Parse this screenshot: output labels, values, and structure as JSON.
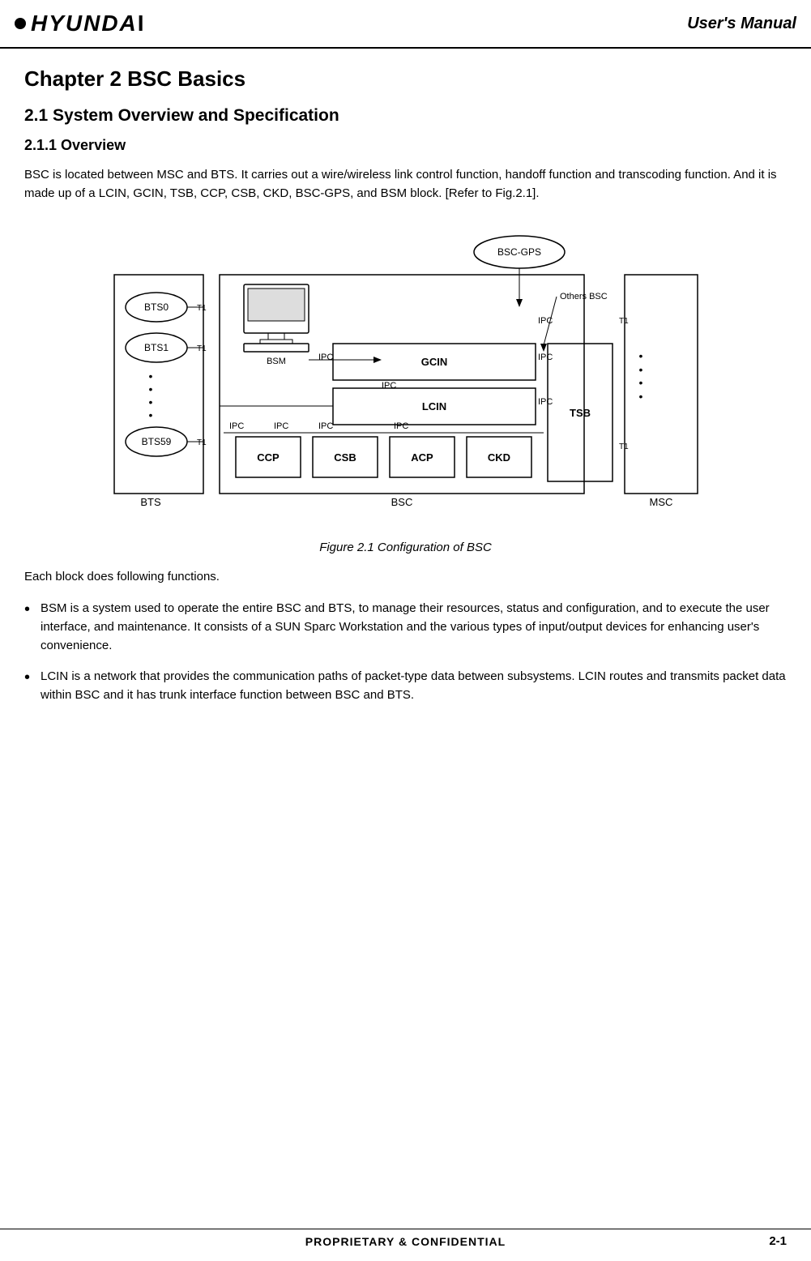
{
  "header": {
    "logo_dot": "•",
    "logo_text": "HYUNDA",
    "title": "User's Manual"
  },
  "chapter": {
    "title": "Chapter 2  BSC Basics"
  },
  "section": {
    "title": "2.1  System Overview and Specification"
  },
  "subsection": {
    "title": "2.1.1  Overview"
  },
  "body1": {
    "text": "BSC is located between MSC and BTS. It carries out a wire/wireless link control function, handoff function and transcoding function. And it is made up of a LCIN, GCIN, TSB, CCP, CSB, CKD, BSC-GPS, and BSM block. [Refer to Fig.2.1]."
  },
  "figure": {
    "caption": "Figure 2.1 Configuration of BSC"
  },
  "body2": {
    "text": "Each block does following functions."
  },
  "bullets": [
    {
      "dot": "•",
      "text": "BSM is a system used to operate the entire BSC and BTS, to manage their resources, status and configuration, and to execute the user interface, and maintenance. It consists of a SUN Sparc Workstation and the various types of input/output devices for enhancing user's convenience."
    },
    {
      "dot": "•",
      "text": "LCIN is a network that provides the communication paths of packet-type data between subsystems. LCIN routes and transmits packet data within BSC and it has trunk interface function between BSC and BTS."
    }
  ],
  "footer": {
    "center": "PROPRIETARY & CONFIDENTIAL",
    "page": "2-1"
  }
}
